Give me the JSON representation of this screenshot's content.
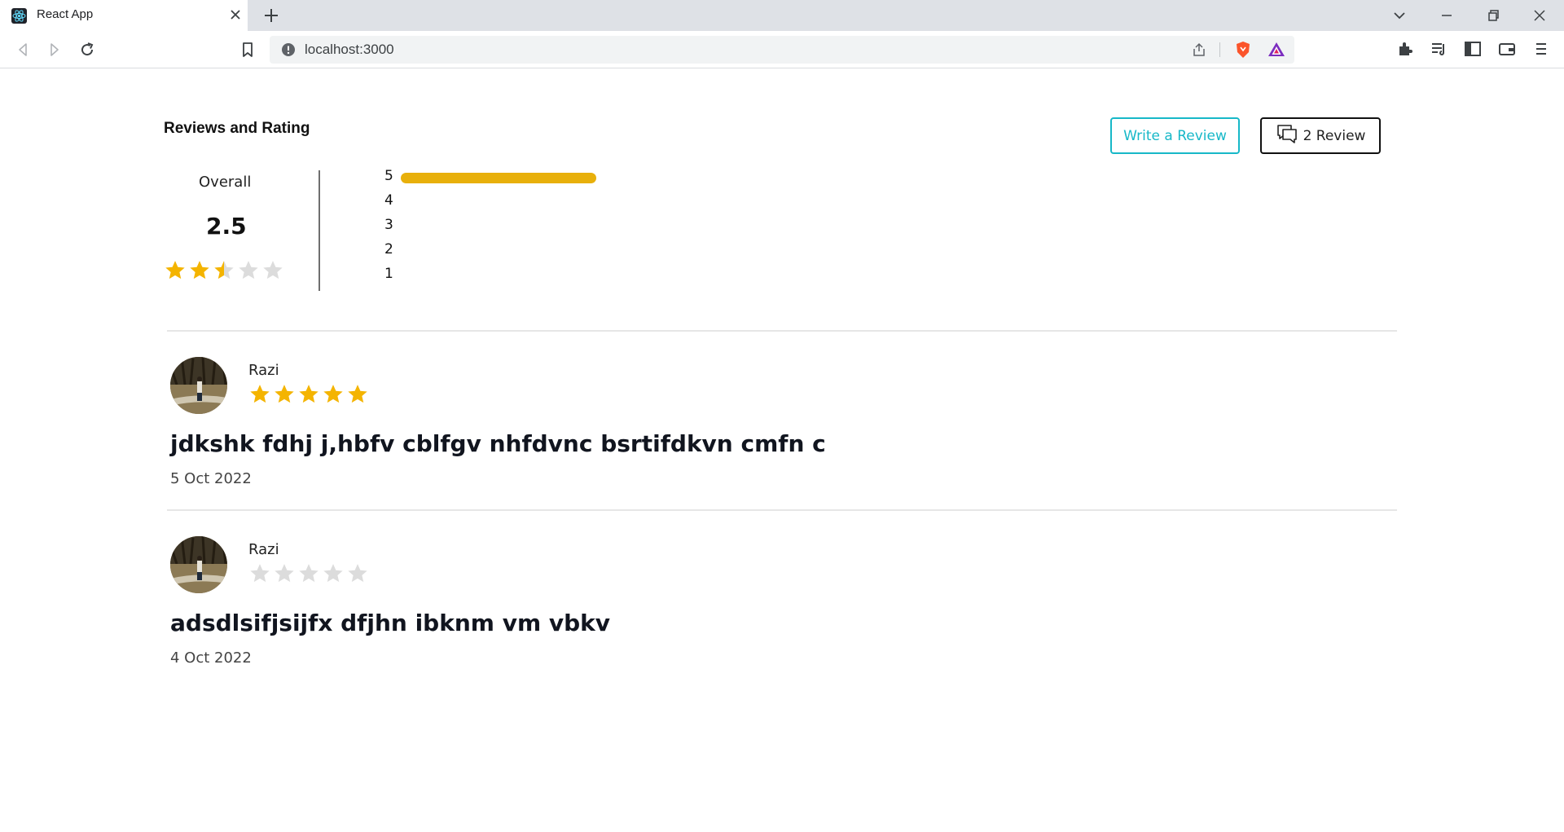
{
  "browser": {
    "tab_title": "React App",
    "url": "localhost:3000"
  },
  "section": {
    "title": "Reviews and Rating",
    "write_button": "Write a Review",
    "count_button": "2 Review"
  },
  "overall": {
    "label": "Overall",
    "value": "2.5",
    "rating": 2.5
  },
  "distribution": [
    {
      "label": "5",
      "fraction": 1.0
    },
    {
      "label": "4",
      "fraction": 0
    },
    {
      "label": "3",
      "fraction": 0
    },
    {
      "label": "2",
      "fraction": 0
    },
    {
      "label": "1",
      "fraction": 0
    }
  ],
  "reviews": [
    {
      "name": "Razi",
      "rating": 5,
      "text": "jdkshk fdhj j,hbfv cblfgv nhfdvnc bsrtifdkvn cmfn c",
      "date": "5 Oct 2022"
    },
    {
      "name": "Razi",
      "rating": 0,
      "text": "adsdlsifjsijfx dfjhn ibknm vm vbkv",
      "date": "4 Oct 2022"
    }
  ],
  "colors": {
    "star_filled": "#f4b400",
    "star_empty": "#dcdcdc",
    "bar": "#e8b00b",
    "accent": "#17b8c8"
  }
}
